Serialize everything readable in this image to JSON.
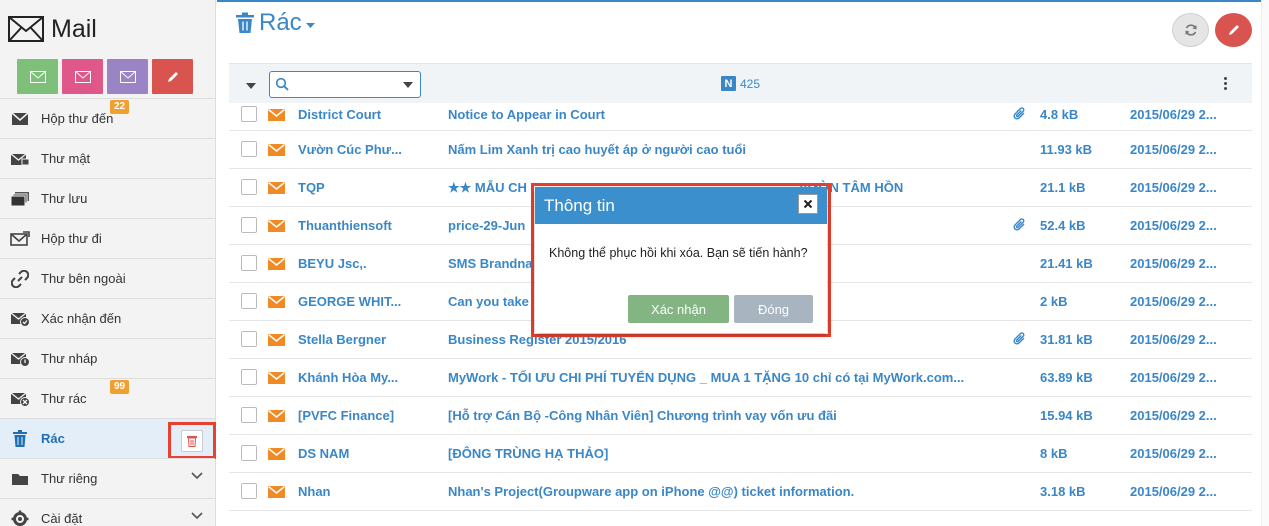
{
  "app": {
    "title": "Mail"
  },
  "colors": {
    "accent": "#3a87c8",
    "danger": "#d9534f",
    "badge": "#f0a030",
    "highlight": "#e8412f"
  },
  "quick_actions": [
    {
      "icon": "envelope-icon",
      "color": "#7ec07a"
    },
    {
      "icon": "envelope-icon",
      "color": "#e0578a"
    },
    {
      "icon": "envelope-icon",
      "color": "#9b84c6"
    },
    {
      "icon": "pencil-icon",
      "color": "#d9534f"
    }
  ],
  "sidebar": {
    "items": [
      {
        "label": "Hộp thư đến",
        "icon": "inbox-icon",
        "badge": "22"
      },
      {
        "label": "Thư mật",
        "icon": "secret-mail-icon"
      },
      {
        "label": "Thư lưu",
        "icon": "archive-icon"
      },
      {
        "label": "Hộp thư đi",
        "icon": "outbox-icon"
      },
      {
        "label": "Thư bên ngoài",
        "icon": "external-link-icon"
      },
      {
        "label": "Xác nhận đến",
        "icon": "confirm-mail-icon"
      },
      {
        "label": "Thư nháp",
        "icon": "draft-icon"
      },
      {
        "label": "Thư rác",
        "icon": "spam-icon",
        "badge": "99"
      },
      {
        "label": "Rác",
        "icon": "trash-icon",
        "active": true
      },
      {
        "label": "Thư riêng",
        "icon": "folder-icon"
      },
      {
        "label": "Cài đặt",
        "icon": "gear-icon"
      }
    ]
  },
  "header": {
    "folder_title": "Rác"
  },
  "toolbar": {
    "search_placeholder": "",
    "count": "425",
    "count_icon": "N"
  },
  "messages": [
    {
      "sender": "District Court",
      "subject": "Notice to Appear in Court",
      "attachment": true,
      "size": "4.8 kB",
      "date": "2015/06/29 2..."
    },
    {
      "sender": "Vườn Cúc Phư...",
      "subject": "Nấm Lim Xanh trị cao huyết áp ở người cao tuổi",
      "attachment": false,
      "size": "11.93 kB",
      "date": "2015/06/29 2..."
    },
    {
      "sender": "TQP",
      "subject": "★★ MẪU CH",
      "subject_tail": "VƯỜN TÂM HỒN",
      "attachment": false,
      "size": "21.1 kB",
      "date": "2015/06/29 2..."
    },
    {
      "sender": "Thuanthiensoft",
      "subject": "price-29-Jun",
      "attachment": true,
      "size": "52.4 kB",
      "date": "2015/06/29 2..."
    },
    {
      "sender": "BEYU Jsc,.",
      "subject": "SMS Brandna",
      "attachment": false,
      "size": "21.41 kB",
      "date": "2015/06/29 2..."
    },
    {
      "sender": "GEORGE WHIT...",
      "subject": "Can you take",
      "attachment": false,
      "size": "2 kB",
      "date": "2015/06/29 2..."
    },
    {
      "sender": "Stella Bergner",
      "subject": "Business Register 2015/2016",
      "attachment": true,
      "size": "31.81 kB",
      "date": "2015/06/29 2..."
    },
    {
      "sender": "Khánh Hòa My...",
      "subject": "MyWork - TỐI ƯU CHI PHÍ TUYỂN DỤNG _ MUA 1 TẶNG 10 chỉ có tại MyWork.com...",
      "attachment": false,
      "size": "63.89 kB",
      "date": "2015/06/29 2..."
    },
    {
      "sender": "[PVFC Finance]",
      "subject": "[Hỗ trợ Cán Bộ -Công Nhân Viên] Chương trình vay vốn ưu đãi",
      "attachment": false,
      "size": "15.94 kB",
      "date": "2015/06/29 2..."
    },
    {
      "sender": "DS NAM",
      "subject": "[ĐÔNG TRÙNG HẠ THẢO]",
      "attachment": false,
      "size": "8 kB",
      "date": "2015/06/29 2..."
    },
    {
      "sender": "Nhan",
      "subject": "Nhan's Project(Groupware app on iPhone @@) ticket information.",
      "attachment": false,
      "size": "3.18 kB",
      "date": "2015/06/29 2..."
    }
  ],
  "dialog": {
    "title": "Thông tin",
    "message": "Không thể phục hồi khi xóa. Bạn sẽ tiến hành?",
    "confirm_label": "Xác nhận",
    "close_label": "Đóng"
  }
}
